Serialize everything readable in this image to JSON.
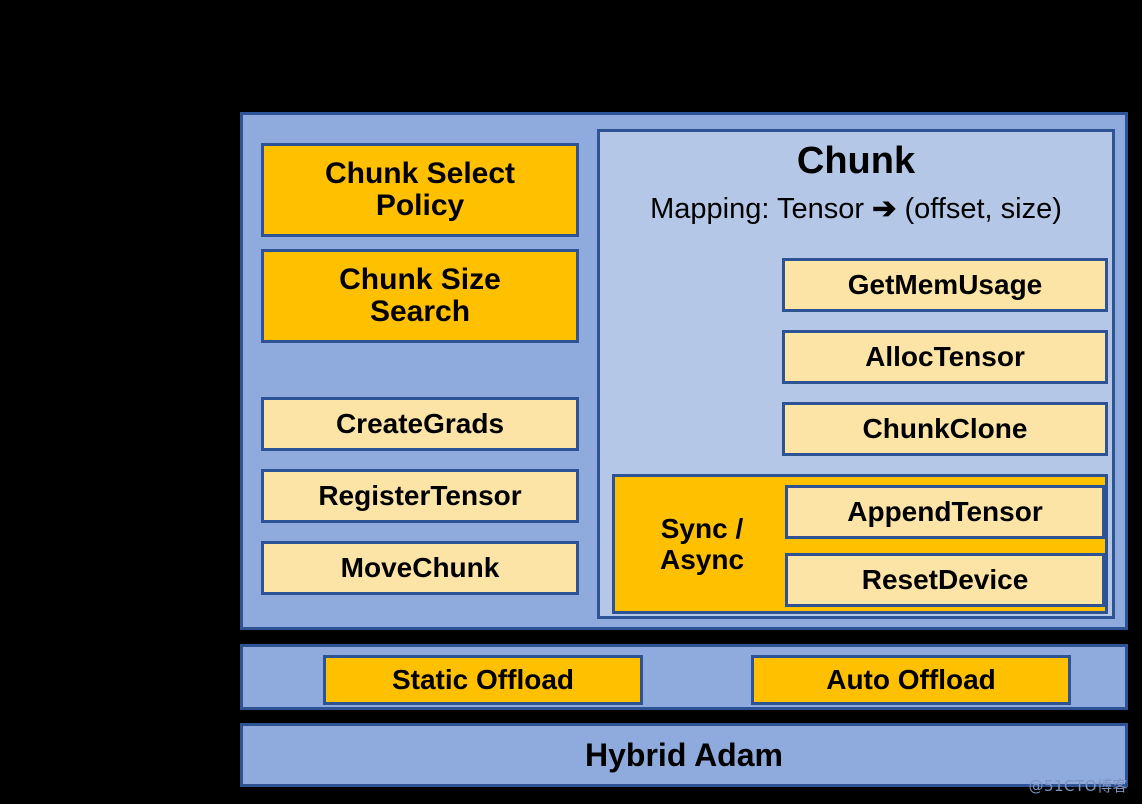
{
  "diagram": {
    "title": "Chunk-based memory management stack",
    "colors": {
      "panel_blue": "#8FAADC",
      "subpanel_blue": "#B4C7E7",
      "border_blue": "#2E5395",
      "orange": "#FFC000",
      "cream": "#FCE4A6",
      "background": "#000000",
      "watermark": "#7E93BE"
    }
  },
  "left_column": {
    "items": [
      {
        "label": "Chunk Select\nPolicy",
        "line1": "Chunk Select",
        "line2": "Policy",
        "style": "orange"
      },
      {
        "label": "Chunk Size\nSearch",
        "line1": "Chunk Size",
        "line2": "Search",
        "style": "orange"
      },
      {
        "label": "CreateGrads",
        "style": "cream"
      },
      {
        "label": "RegisterTensor",
        "style": "cream"
      },
      {
        "label": "MoveChunk",
        "style": "cream"
      }
    ]
  },
  "chunk_panel": {
    "title": "Chunk",
    "mapping_prefix": "Mapping: Tensor ",
    "mapping_arrow": "➔",
    "mapping_suffix": " (offset, size)",
    "mapping_full": "Mapping: Tensor ➔ (offset, size)",
    "methods": [
      {
        "label": "GetMemUsage",
        "style": "cream"
      },
      {
        "label": "AllocTensor",
        "style": "cream"
      },
      {
        "label": "ChunkClone",
        "style": "cream"
      }
    ],
    "sync_async": {
      "label_line1": "Sync /",
      "label_line2": "Async",
      "label": "Sync / Async",
      "style": "orange",
      "methods": [
        {
          "label": "AppendTensor",
          "style": "cream"
        },
        {
          "label": "ResetDevice",
          "style": "cream"
        }
      ]
    }
  },
  "offload_row": {
    "items": [
      {
        "label": "Static Offload",
        "style": "orange"
      },
      {
        "label": "Auto Offload",
        "style": "orange"
      }
    ]
  },
  "adam_row": {
    "label": "Hybrid Adam"
  },
  "watermark": {
    "text": "@51CTO博客"
  }
}
